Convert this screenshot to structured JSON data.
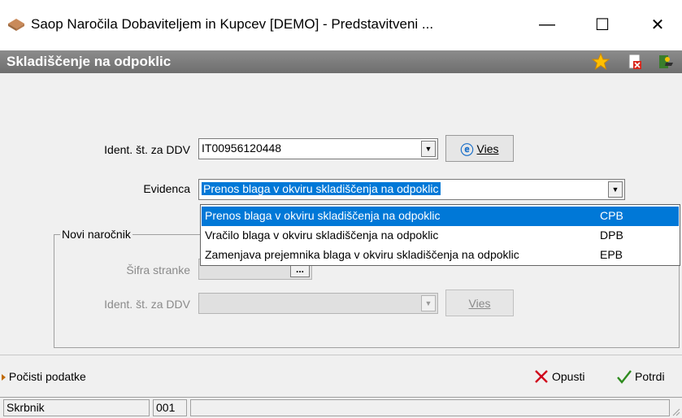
{
  "window": {
    "title": "Saop  Naročila Dobaviteljem in Kupcev [DEMO] - Predstavitveni ...",
    "minimize": "—",
    "maximize": "☐",
    "close": "✕"
  },
  "header": {
    "title": "Skladiščenje na odpoklic",
    "icons": [
      "star-icon",
      "delete-doc-icon",
      "exit-door-icon"
    ]
  },
  "form": {
    "ddv_label": "Ident. št. za DDV",
    "ddv_value": "IT00956120448",
    "vies_label": "Vies",
    "evidenca_label": "Evidenca",
    "evidenca_value": "Prenos blaga v okviru skladiščenja na odpoklic"
  },
  "dropdown": {
    "items": [
      {
        "label": "Prenos blaga v okviru skladiščenja na odpoklic",
        "code": "CPB",
        "selected": true
      },
      {
        "label": "Vračilo blaga v okviru skladiščenja na odpoklic",
        "code": "DPB",
        "selected": false
      },
      {
        "label": "Zamenjava prejemnika blaga v okviru skladiščenja na odpoklic",
        "code": "EPB",
        "selected": false
      }
    ]
  },
  "group": {
    "title": "Novi naročnik",
    "sifra_label": "Šifra stranke",
    "ellipsis": "...",
    "ddv_label": "Ident. št. za DDV",
    "vies_label": "Vies"
  },
  "actions": {
    "clear_label": "Počisti podatke",
    "cancel_label": "Opusti",
    "confirm_label": "Potrdi"
  },
  "status": {
    "user": "Skrbnik",
    "code": "001"
  },
  "colors": {
    "selection": "#0078d7",
    "header_bg": "#7a7a7a",
    "cancel_x": "#d0021b",
    "confirm_check": "#2e8b1e"
  }
}
